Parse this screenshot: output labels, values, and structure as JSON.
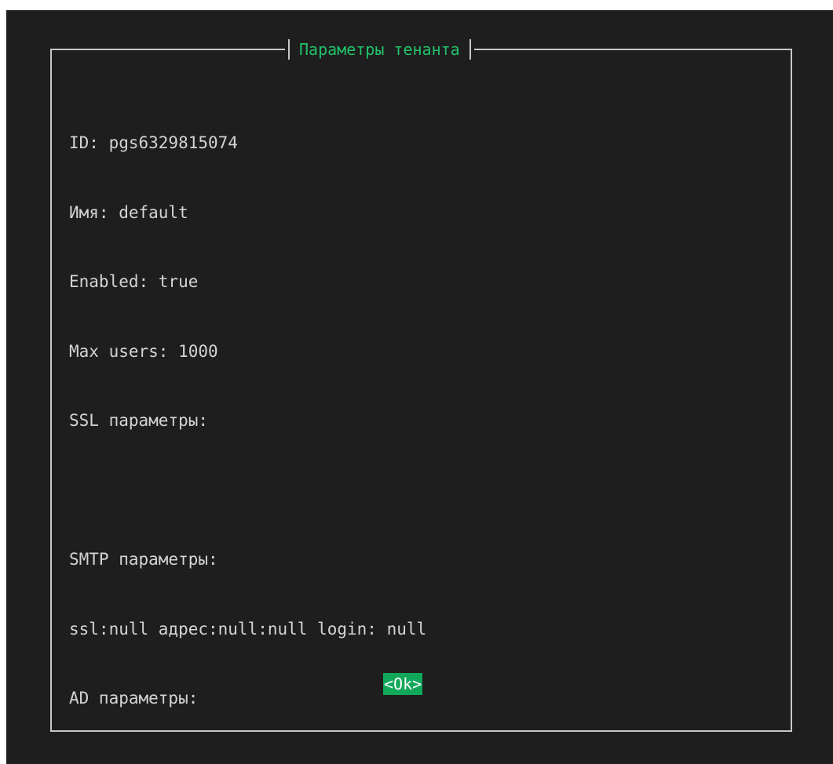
{
  "dialog": {
    "title": "Параметры тенанта",
    "lines": [
      "ID: pgs6329815074",
      "Имя: default",
      "Enabled: true",
      "Max users: 1000",
      "SSL параметры:",
      "",
      "SMTP параметры:",
      "ssl:null адрес:null:null login: null",
      "AD параметры:"
    ],
    "ok_label": "<Ok>"
  },
  "colors": {
    "background": "#1e1e1e",
    "text": "#d4d4d4",
    "title": "#1fc26a",
    "button_bg": "#12a85a",
    "border": "#c8c8c8"
  }
}
